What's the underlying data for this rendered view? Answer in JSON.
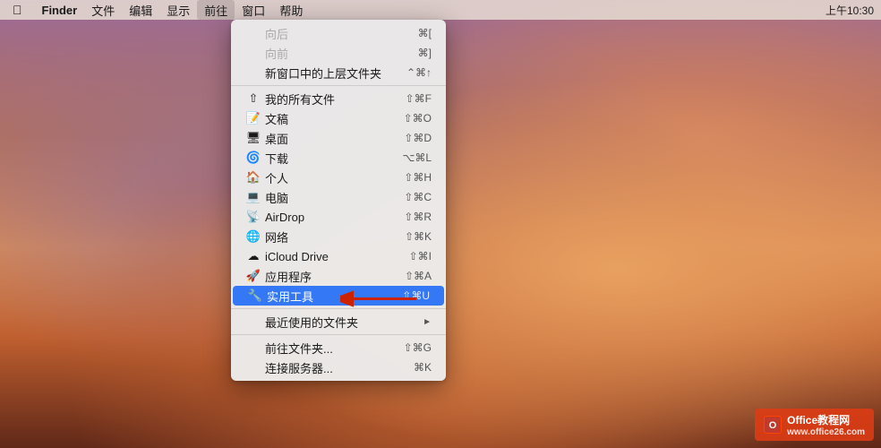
{
  "menubar": {
    "apple": "",
    "items": [
      {
        "label": "Finder",
        "bold": true
      },
      {
        "label": "文件"
      },
      {
        "label": "编辑"
      },
      {
        "label": "显示"
      },
      {
        "label": "前往",
        "active": true
      },
      {
        "label": "窗口"
      },
      {
        "label": "帮助"
      }
    ],
    "right": {
      "time": "上午10:30"
    }
  },
  "dropdown": {
    "items": [
      {
        "id": "back",
        "icon": "",
        "label": "向后",
        "shortcut": "⌘[",
        "disabled": true
      },
      {
        "id": "forward",
        "icon": "",
        "label": "向前",
        "shortcut": "⌘]",
        "disabled": true
      },
      {
        "id": "enclosing",
        "icon": "",
        "label": "新窗口中的上层文件夹",
        "shortcut": "⌃⌘↑"
      },
      {
        "id": "sep1",
        "type": "separator"
      },
      {
        "id": "allfiles",
        "icon": "📄",
        "label": "我的所有文件",
        "shortcut": "⇧⌘F"
      },
      {
        "id": "documents",
        "icon": "📝",
        "label": "文稿",
        "shortcut": "⇧⌘O"
      },
      {
        "id": "desktop",
        "icon": "🖥",
        "label": "桌面",
        "shortcut": "⇧⌘D"
      },
      {
        "id": "downloads",
        "icon": "🌀",
        "label": "下载",
        "shortcut": "⌥⌘L"
      },
      {
        "id": "home",
        "icon": "🏠",
        "label": "个人",
        "shortcut": "⇧⌘H"
      },
      {
        "id": "computer",
        "icon": "💻",
        "label": "电脑",
        "shortcut": "⇧⌘C"
      },
      {
        "id": "airdrop",
        "icon": "📡",
        "label": "AirDrop",
        "shortcut": "⇧⌘R"
      },
      {
        "id": "network",
        "icon": "🌐",
        "label": "网络",
        "shortcut": "⇧⌘K"
      },
      {
        "id": "icloud",
        "icon": "☁",
        "label": "iCloud Drive",
        "shortcut": "⇧⌘I"
      },
      {
        "id": "applications",
        "icon": "🚀",
        "label": "应用程序",
        "shortcut": "⇧⌘A"
      },
      {
        "id": "utilities",
        "icon": "🔧",
        "label": "实用工具",
        "shortcut": "⇧⌘U",
        "highlighted": true
      },
      {
        "id": "sep2",
        "type": "separator"
      },
      {
        "id": "recent",
        "icon": "",
        "label": "最近使用的文件夹",
        "hasArrow": true
      },
      {
        "id": "sep3",
        "type": "separator"
      },
      {
        "id": "goto",
        "icon": "",
        "label": "前往文件夹...",
        "shortcut": "⇧⌘G"
      },
      {
        "id": "connect",
        "icon": "",
        "label": "连接服务器...",
        "shortcut": "⌘K"
      }
    ]
  },
  "watermark": {
    "icon": "O",
    "text": "Office教程网",
    "subtext": "www.office26.com"
  }
}
